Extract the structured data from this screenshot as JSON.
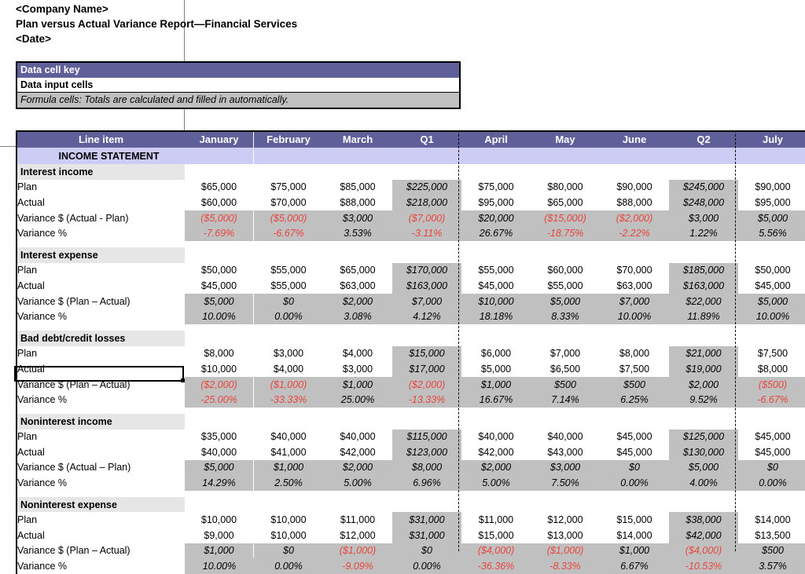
{
  "title_block": {
    "company": "<Company Name>",
    "report_title": "Plan versus Actual Variance Report—Financial Services",
    "date": "<Date>"
  },
  "legend": {
    "header": "Data cell key",
    "input_cells": "Data input cells",
    "formula_cells": "Formula cells: Totals are calculated and filled in automatically."
  },
  "colors": {
    "header_purple": "#5f5f99",
    "banner_lavender": "#ccccf5",
    "formula_gray": "#c0c0c0",
    "group_gray": "#e6e6e6",
    "negative_red": "#e8453c"
  },
  "table": {
    "columns": [
      "Line item",
      "January",
      "February",
      "March",
      "Q1",
      "April",
      "May",
      "June",
      "Q2",
      "July"
    ],
    "banner": "INCOME STATEMENT",
    "groups": [
      {
        "name": "Interest income",
        "rows": [
          {
            "label": "Plan",
            "kind": "input",
            "values": [
              "$65,000",
              "$75,000",
              "$85,000",
              "$225,000",
              "$75,000",
              "$80,000",
              "$90,000",
              "$245,000",
              "$90,000"
            ]
          },
          {
            "label": "Actual",
            "kind": "input",
            "values": [
              "$60,000",
              "$70,000",
              "$88,000",
              "$218,000",
              "$95,000",
              "$65,000",
              "$88,000",
              "$248,000",
              "$95,000"
            ]
          },
          {
            "label": "Variance $ (Actual - Plan)",
            "kind": "formula",
            "values": [
              "($5,000)",
              "($5,000)",
              "$3,000",
              "($7,000)",
              "$20,000",
              "($15,000)",
              "($2,000)",
              "$3,000",
              "$5,000"
            ]
          },
          {
            "label": "Variance %",
            "kind": "formula",
            "values": [
              "-7.69%",
              "-6.67%",
              "3.53%",
              "-3.11%",
              "26.67%",
              "-18.75%",
              "-2.22%",
              "1.22%",
              "5.56%"
            ]
          }
        ]
      },
      {
        "name": "Interest expense",
        "rows": [
          {
            "label": "Plan",
            "kind": "input",
            "values": [
              "$50,000",
              "$55,000",
              "$65,000",
              "$170,000",
              "$55,000",
              "$60,000",
              "$70,000",
              "$185,000",
              "$50,000"
            ]
          },
          {
            "label": "Actual",
            "kind": "input",
            "values": [
              "$45,000",
              "$55,000",
              "$63,000",
              "$163,000",
              "$45,000",
              "$55,000",
              "$63,000",
              "$163,000",
              "$45,000"
            ]
          },
          {
            "label": "Variance $ (Plan – Actual)",
            "kind": "formula",
            "values": [
              "$5,000",
              "$0",
              "$2,000",
              "$7,000",
              "$10,000",
              "$5,000",
              "$7,000",
              "$22,000",
              "$5,000"
            ]
          },
          {
            "label": "Variance %",
            "kind": "formula",
            "values": [
              "10.00%",
              "0.00%",
              "3.08%",
              "4.12%",
              "18.18%",
              "8.33%",
              "10.00%",
              "11.89%",
              "10.00%"
            ]
          }
        ]
      },
      {
        "name": "Bad debt/credit losses",
        "rows": [
          {
            "label": "Plan",
            "kind": "input",
            "values": [
              "$8,000",
              "$3,000",
              "$4,000",
              "$15,000",
              "$6,000",
              "$7,000",
              "$8,000",
              "$21,000",
              "$7,500"
            ]
          },
          {
            "label": "Actual",
            "kind": "input",
            "values": [
              "$10,000",
              "$4,000",
              "$3,000",
              "$17,000",
              "$5,000",
              "$6,500",
              "$7,500",
              "$19,000",
              "$8,000"
            ]
          },
          {
            "label": "Variance $ (Plan – Actual)",
            "kind": "formula",
            "selected": true,
            "values": [
              "($2,000)",
              "($1,000)",
              "$1,000",
              "($2,000)",
              "$1,000",
              "$500",
              "$500",
              "$2,000",
              "($500)"
            ]
          },
          {
            "label": "Variance %",
            "kind": "formula",
            "values": [
              "-25.00%",
              "-33.33%",
              "25.00%",
              "-13.33%",
              "16.67%",
              "7.14%",
              "6.25%",
              "9.52%",
              "-6.67%"
            ]
          }
        ]
      },
      {
        "name": "Noninterest income",
        "rows": [
          {
            "label": "Plan",
            "kind": "input",
            "values": [
              "$35,000",
              "$40,000",
              "$40,000",
              "$115,000",
              "$40,000",
              "$40,000",
              "$45,000",
              "$125,000",
              "$45,000"
            ]
          },
          {
            "label": "Actual",
            "kind": "input",
            "values": [
              "$40,000",
              "$41,000",
              "$42,000",
              "$123,000",
              "$42,000",
              "$43,000",
              "$45,000",
              "$130,000",
              "$45,000"
            ]
          },
          {
            "label": "Variance $ (Actual – Plan)",
            "kind": "formula",
            "values": [
              "$5,000",
              "$1,000",
              "$2,000",
              "$8,000",
              "$2,000",
              "$3,000",
              "$0",
              "$5,000",
              "$0"
            ]
          },
          {
            "label": "Variance %",
            "kind": "formula",
            "values": [
              "14.29%",
              "2.50%",
              "5.00%",
              "6.96%",
              "5.00%",
              "7.50%",
              "0.00%",
              "4.00%",
              "0.00%"
            ]
          }
        ]
      },
      {
        "name": "Noninterest expense",
        "rows": [
          {
            "label": "Plan",
            "kind": "input",
            "values": [
              "$10,000",
              "$10,000",
              "$11,000",
              "$31,000",
              "$11,000",
              "$12,000",
              "$15,000",
              "$38,000",
              "$14,000"
            ]
          },
          {
            "label": "Actual",
            "kind": "input",
            "values": [
              "$9,000",
              "$10,000",
              "$12,000",
              "$31,000",
              "$15,000",
              "$13,000",
              "$14,000",
              "$42,000",
              "$13,500"
            ]
          },
          {
            "label": "Variance $ (Plan – Actual)",
            "kind": "formula",
            "values": [
              "$1,000",
              "$0",
              "($1,000)",
              "$0",
              "($4,000)",
              "($1,000)",
              "$1,000",
              "($4,000)",
              "$500"
            ]
          },
          {
            "label": "Variance %",
            "kind": "formula",
            "values": [
              "10.00%",
              "0.00%",
              "-9.09%",
              "0.00%",
              "-36.36%",
              "-8.33%",
              "6.67%",
              "-10.53%",
              "3.57%"
            ]
          }
        ]
      }
    ]
  }
}
